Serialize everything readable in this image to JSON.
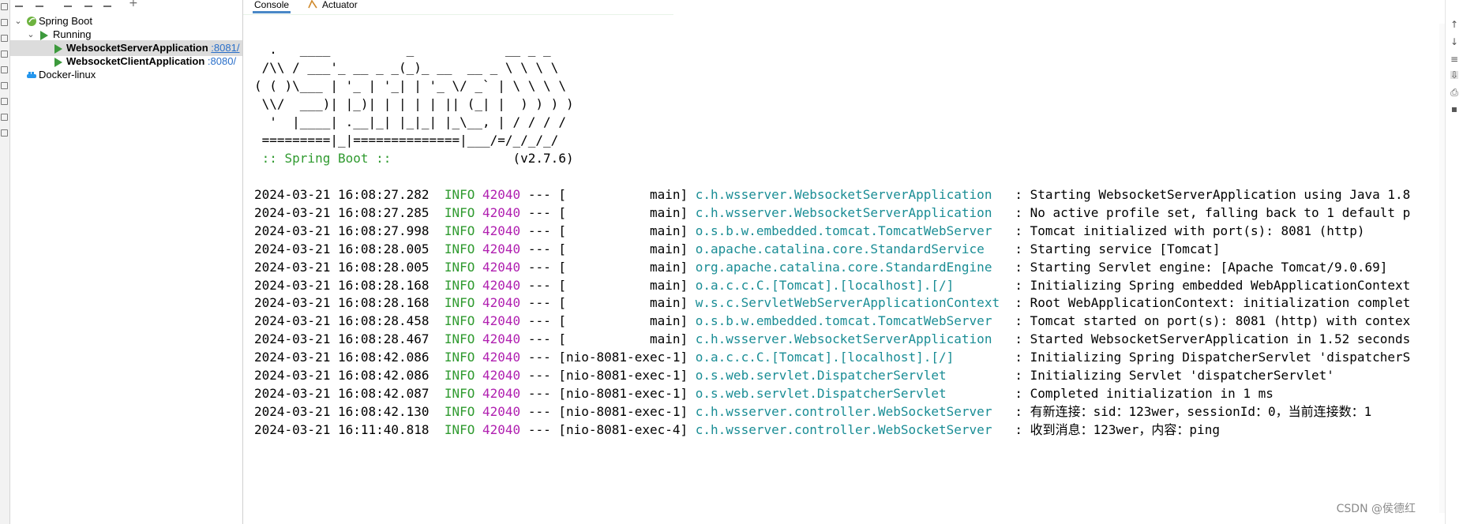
{
  "tree": {
    "root": "Spring Boot",
    "group": "Running",
    "apps": [
      {
        "name": "WebsocketServerApplication",
        "port": ":8081/"
      },
      {
        "name": "WebsocketClientApplication",
        "port": ":8080/"
      }
    ],
    "docker": "Docker-linux"
  },
  "tabs": {
    "console": "Console",
    "actuator": "Actuator"
  },
  "banner": {
    "lines": [
      "  .   ____          _            __ _ _",
      " /\\\\ / ___'_ __ _ _(_)_ __  __ _ \\ \\ \\ \\",
      "( ( )\\___ | '_ | '_| | '_ \\/ _` | \\ \\ \\ \\",
      " \\\\/  ___)| |_)| | | | | || (_| |  ) ) ) )",
      "  '  |____| .__|_| |_|_| |_\\__, | / / / /",
      " =========|_|==============|___/=/_/_/_/"
    ],
    "brand": " :: Spring Boot ::",
    "version": "(v2.7.6)"
  },
  "logs": [
    {
      "ts": "2024-03-21 16:08:27.282",
      "level": "INFO",
      "pid": "42040",
      "sep": "---",
      "thread": "[           main]",
      "logger": "c.h.wsserver.WebsocketServerApplication  ",
      "msg": ": Starting WebsocketServerApplication using Java 1.8"
    },
    {
      "ts": "2024-03-21 16:08:27.285",
      "level": "INFO",
      "pid": "42040",
      "sep": "---",
      "thread": "[           main]",
      "logger": "c.h.wsserver.WebsocketServerApplication  ",
      "msg": ": No active profile set, falling back to 1 default p"
    },
    {
      "ts": "2024-03-21 16:08:27.998",
      "level": "INFO",
      "pid": "42040",
      "sep": "---",
      "thread": "[           main]",
      "logger": "o.s.b.w.embedded.tomcat.TomcatWebServer  ",
      "msg": ": Tomcat initialized with port(s): 8081 (http)"
    },
    {
      "ts": "2024-03-21 16:08:28.005",
      "level": "INFO",
      "pid": "42040",
      "sep": "---",
      "thread": "[           main]",
      "logger": "o.apache.catalina.core.StandardService   ",
      "msg": ": Starting service [Tomcat]"
    },
    {
      "ts": "2024-03-21 16:08:28.005",
      "level": "INFO",
      "pid": "42040",
      "sep": "---",
      "thread": "[           main]",
      "logger": "org.apache.catalina.core.StandardEngine  ",
      "msg": ": Starting Servlet engine: [Apache Tomcat/9.0.69]"
    },
    {
      "ts": "2024-03-21 16:08:28.168",
      "level": "INFO",
      "pid": "42040",
      "sep": "---",
      "thread": "[           main]",
      "logger": "o.a.c.c.C.[Tomcat].[localhost].[/]       ",
      "msg": ": Initializing Spring embedded WebApplicationContext"
    },
    {
      "ts": "2024-03-21 16:08:28.168",
      "level": "INFO",
      "pid": "42040",
      "sep": "---",
      "thread": "[           main]",
      "logger": "w.s.c.ServletWebServerApplicationContext ",
      "msg": ": Root WebApplicationContext: initialization complet"
    },
    {
      "ts": "2024-03-21 16:08:28.458",
      "level": "INFO",
      "pid": "42040",
      "sep": "---",
      "thread": "[           main]",
      "logger": "o.s.b.w.embedded.tomcat.TomcatWebServer  ",
      "msg": ": Tomcat started on port(s): 8081 (http) with contex"
    },
    {
      "ts": "2024-03-21 16:08:28.467",
      "level": "INFO",
      "pid": "42040",
      "sep": "---",
      "thread": "[           main]",
      "logger": "c.h.wsserver.WebsocketServerApplication  ",
      "msg": ": Started WebsocketServerApplication in 1.52 seconds"
    },
    {
      "ts": "2024-03-21 16:08:42.086",
      "level": "INFO",
      "pid": "42040",
      "sep": "---",
      "thread": "[nio-8081-exec-1]",
      "logger": "o.a.c.c.C.[Tomcat].[localhost].[/]       ",
      "msg": ": Initializing Spring DispatcherServlet 'dispatcherS"
    },
    {
      "ts": "2024-03-21 16:08:42.086",
      "level": "INFO",
      "pid": "42040",
      "sep": "---",
      "thread": "[nio-8081-exec-1]",
      "logger": "o.s.web.servlet.DispatcherServlet        ",
      "msg": ": Initializing Servlet 'dispatcherServlet'"
    },
    {
      "ts": "2024-03-21 16:08:42.087",
      "level": "INFO",
      "pid": "42040",
      "sep": "---",
      "thread": "[nio-8081-exec-1]",
      "logger": "o.s.web.servlet.DispatcherServlet        ",
      "msg": ": Completed initialization in 1 ms"
    },
    {
      "ts": "2024-03-21 16:08:42.130",
      "level": "INFO",
      "pid": "42040",
      "sep": "---",
      "thread": "[nio-8081-exec-1]",
      "logger": "c.h.wsserver.controller.WebSocketServer  ",
      "msg": ": 有新连接：sid：123wer，sessionId：0，当前连接数：1"
    },
    {
      "ts": "2024-03-21 16:11:40.818",
      "level": "INFO",
      "pid": "42040",
      "sep": "---",
      "thread": "[nio-8081-exec-4]",
      "logger": "c.h.wsserver.controller.WebSocketServer  ",
      "msg": ": 收到消息：123wer，内容：ping"
    }
  ],
  "watermark": "CSDN @侯德红",
  "colors": {
    "info": "#2f9a2f",
    "pid": "#b01fb0",
    "logger": "#1a8d95",
    "run": "#3d9a3d",
    "link": "#2a6fc9"
  }
}
